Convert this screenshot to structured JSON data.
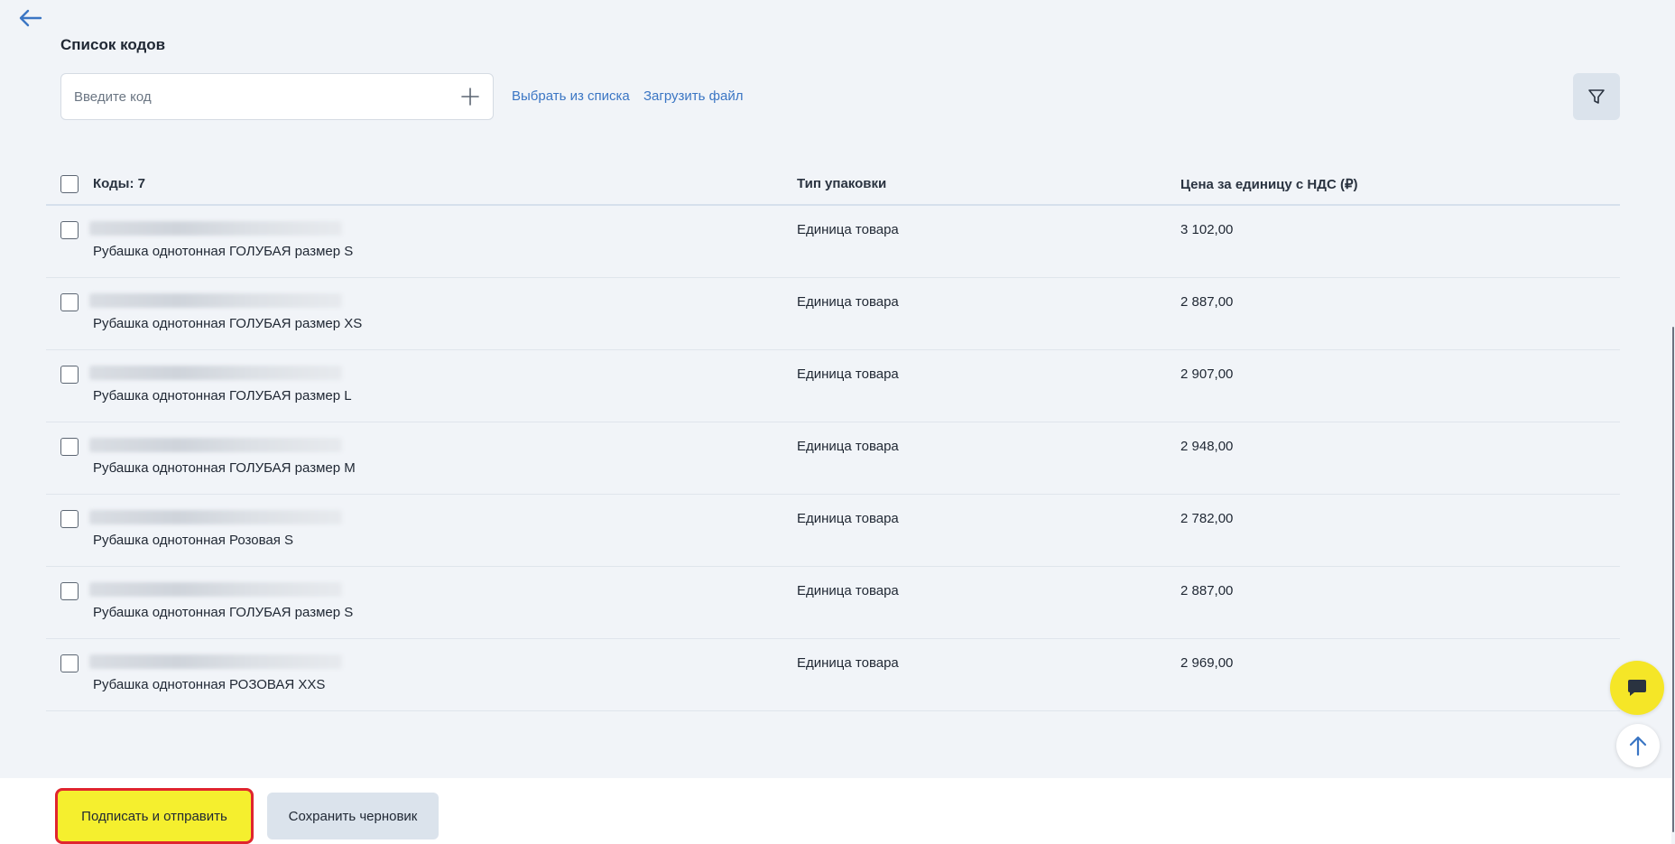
{
  "header": {
    "back_icon": "arrow-left-icon",
    "title": "Список кодов"
  },
  "search": {
    "placeholder": "Введите код",
    "value": "",
    "add_icon": "plus-icon"
  },
  "actions": {
    "choose_from_list": "Выбрать из списка",
    "upload_file": "Загрузить файл",
    "filter_icon": "filter-icon"
  },
  "table": {
    "columns": {
      "codes": "Коды: 7",
      "package_type": "Тип упаковки",
      "price": "Цена за единицу с НДС (₽)"
    },
    "rows": [
      {
        "name": "Рубашка однотонная ГОЛУБАЯ размер S",
        "package": "Единица товара",
        "price": "3 102,00"
      },
      {
        "name": "Рубашка однотонная ГОЛУБАЯ размер XS",
        "package": "Единица товара",
        "price": "2 887,00"
      },
      {
        "name": "Рубашка однотонная ГОЛУБАЯ размер L",
        "package": "Единица товара",
        "price": "2 907,00"
      },
      {
        "name": "Рубашка однотонная ГОЛУБАЯ размер M",
        "package": "Единица товара",
        "price": "2 948,00"
      },
      {
        "name": "Рубашка однотонная Розовая S",
        "package": "Единица товара",
        "price": "2 782,00"
      },
      {
        "name": "Рубашка однотонная ГОЛУБАЯ размер S",
        "package": "Единица товара",
        "price": "2 887,00"
      },
      {
        "name": "Рубашка однотонная РОЗОВАЯ XXS",
        "package": "Единица товара",
        "price": "2 969,00"
      }
    ]
  },
  "floating": {
    "chat_icon": "chat-bubble-icon",
    "scroll_top_icon": "arrow-up-icon"
  },
  "footer": {
    "sign_and_send": "Подписать и отправить",
    "save_draft": "Сохранить черновик"
  },
  "colors": {
    "accent_yellow": "#f5ef2e",
    "link_blue": "#3b76c4",
    "highlight_red": "#e0252e",
    "background": "#f1f4f8"
  }
}
